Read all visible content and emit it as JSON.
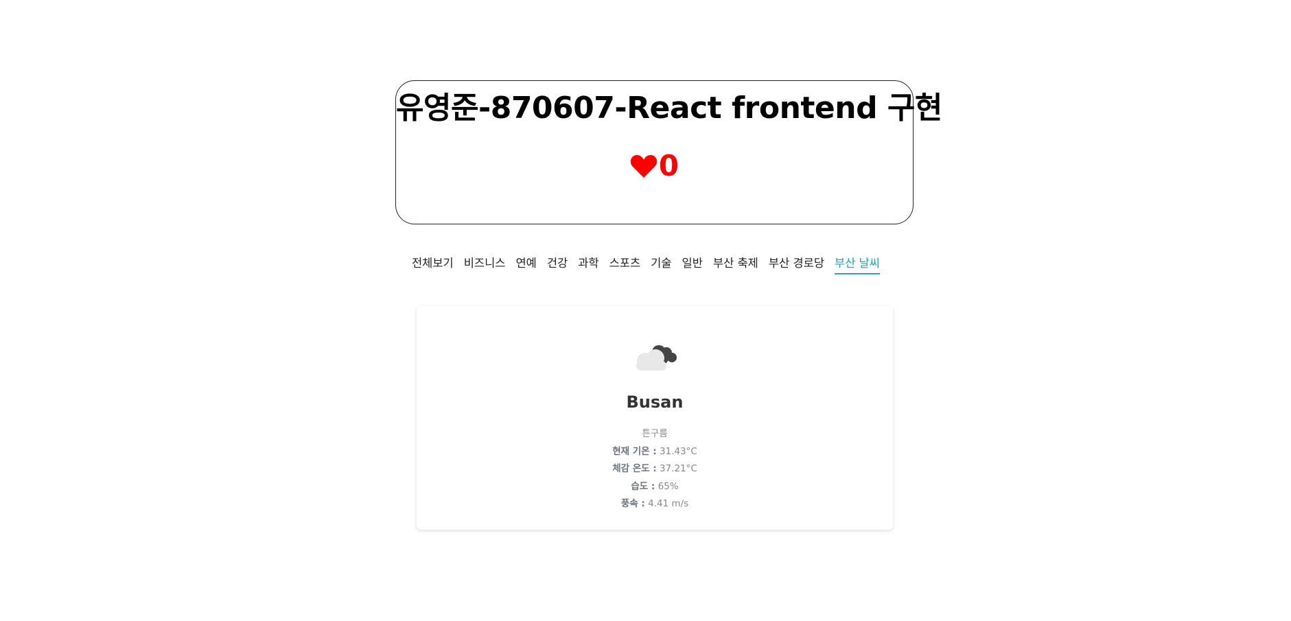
{
  "header": {
    "title": "유영준-870607-React frontend 구현",
    "like_count": "0"
  },
  "nav": {
    "items": [
      {
        "label": "전체보기",
        "active": false
      },
      {
        "label": "비즈니스",
        "active": false
      },
      {
        "label": "연예",
        "active": false
      },
      {
        "label": "건강",
        "active": false
      },
      {
        "label": "과학",
        "active": false
      },
      {
        "label": "스포츠",
        "active": false
      },
      {
        "label": "기술",
        "active": false
      },
      {
        "label": "일반",
        "active": false
      },
      {
        "label": "부산 축제",
        "active": false
      },
      {
        "label": "부산 경로당",
        "active": false
      },
      {
        "label": "부산 날씨",
        "active": true
      }
    ]
  },
  "weather": {
    "icon": "broken-clouds-icon",
    "city": "Busan",
    "description": "튼구름",
    "temp_label": "현재 기온 :",
    "temp_value": "31.43°C",
    "feels_label": "체감 온도 :",
    "feels_value": "37.21°C",
    "humidity_label": "습도 :",
    "humidity_value": "65%",
    "wind_label": "풍속 :",
    "wind_value": "4.41 m/s"
  },
  "colors": {
    "accent": "#17a2b8",
    "heart": "#ff0000"
  }
}
